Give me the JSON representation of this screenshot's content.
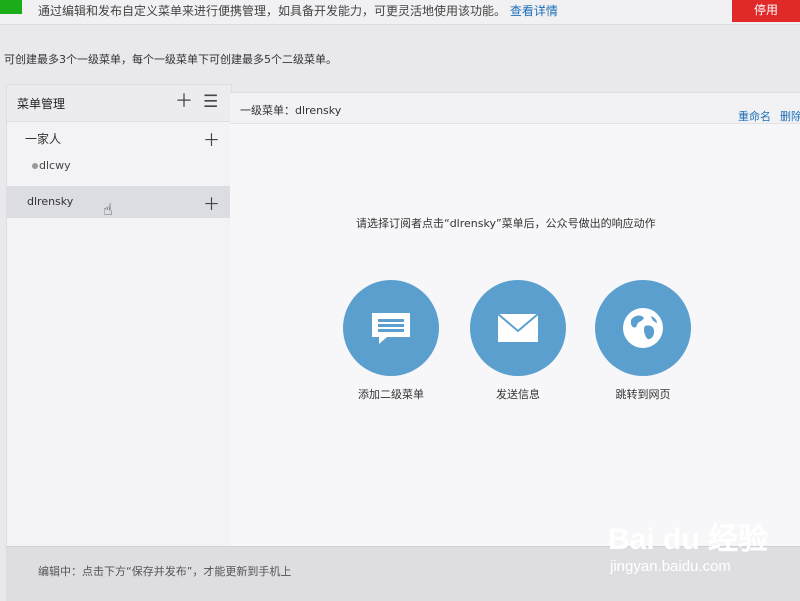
{
  "notice_bar": {
    "text": "通过编辑和发布自定义菜单来进行便携管理，如具备开发能力，可更灵活地使用该功能。",
    "link": "查看详情",
    "stop_button": "停用"
  },
  "limit_tip": "可创建最多3个一级菜单，每个一级菜单下可创建最多5个二级菜单。",
  "menu_manager": {
    "title": "菜单管理",
    "add_icon": "plus-icon",
    "sort_icon": "list-icon",
    "items": [
      {
        "label": "一家人",
        "children": [
          {
            "label": "dlcwy"
          }
        ]
      },
      {
        "label": "dlrensky",
        "selected": true,
        "children": []
      }
    ]
  },
  "editor": {
    "title": "一级菜单：dlrensky",
    "rename": "重命名",
    "delete": "删除",
    "prompt": "请选择订阅者点击“dlrensky”菜单后，公众号做出的响应动作",
    "actions": [
      {
        "label": "添加二级菜单",
        "icon": "message-icon"
      },
      {
        "label": "发送信息",
        "icon": "envelope-icon"
      },
      {
        "label": "跳转到网页",
        "icon": "globe-icon"
      }
    ]
  },
  "footer": {
    "text": "编辑中：点击下方“保存并发布”，才能更新到手机上"
  },
  "watermark": {
    "brand": "Bai du 经验",
    "url": "jingyan.baidu.com"
  },
  "colors": {
    "accent": "#5b9fcf",
    "link": "#1d6fb8",
    "danger": "#e02a2a"
  }
}
